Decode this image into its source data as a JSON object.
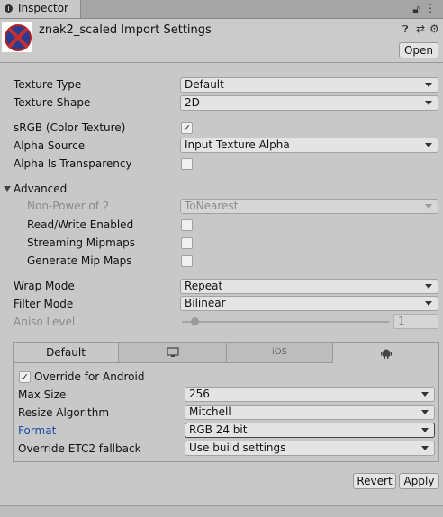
{
  "window": {
    "tab_label": "Inspector",
    "tab_icons": "⋮≡",
    "tab_right_icons": "⋮"
  },
  "header": {
    "title": "znak2_scaled Import Settings",
    "icons": "?⚌⚙",
    "open_label": "Open"
  },
  "fields": {
    "texture_type": {
      "label": "Texture Type",
      "value": "Default"
    },
    "texture_shape": {
      "label": "Texture Shape",
      "value": "2D"
    },
    "srgb": {
      "label": "sRGB (Color Texture)",
      "checked": "✓"
    },
    "alpha_source": {
      "label": "Alpha Source",
      "value": "Input Texture Alpha"
    },
    "alpha_is_transparency": {
      "label": "Alpha Is Transparency",
      "checked": ""
    },
    "advanced": {
      "label": "Advanced"
    },
    "npot": {
      "label": "Non-Power of 2",
      "value": "ToNearest"
    },
    "read_write": {
      "label": "Read/Write Enabled",
      "checked": ""
    },
    "streaming": {
      "label": "Streaming Mipmaps",
      "checked": ""
    },
    "gen_mips": {
      "label": "Generate Mip Maps",
      "checked": ""
    },
    "wrap_mode": {
      "label": "Wrap Mode",
      "value": "Repeat"
    },
    "filter_mode": {
      "label": "Filter Mode",
      "value": "Bilinear"
    },
    "aniso": {
      "label": "Aniso Level",
      "value": "1",
      "fraction": 0.0
    }
  },
  "platform": {
    "tabs": [
      {
        "label": "Default",
        "icon": ""
      },
      {
        "label": "",
        "icon": "monitor-icon"
      },
      {
        "label": "iOS",
        "icon": ""
      },
      {
        "label": "",
        "icon": "android-icon"
      }
    ],
    "override": {
      "label": "Override for Android",
      "checked": "✓"
    },
    "max_size": {
      "label": "Max Size",
      "value": "256"
    },
    "resize": {
      "label": "Resize Algorithm",
      "value": "Mitchell"
    },
    "format": {
      "label": "Format",
      "value": "RGB 24 bit"
    },
    "etc2": {
      "label": "Override ETC2 fallback",
      "value": "Use build settings"
    }
  },
  "actions": {
    "revert": "Revert",
    "apply": "Apply"
  }
}
